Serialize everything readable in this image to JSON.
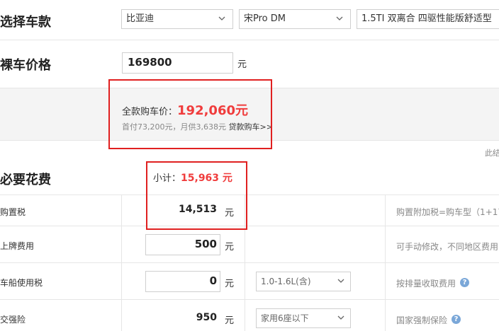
{
  "select_car": {
    "title": "选择车款",
    "brand": "比亚迪",
    "series": "宋Pro DM",
    "model": "1.5TI 双离合 四驱性能版舒适型"
  },
  "bare_price": {
    "title": "裸车价格",
    "value": "169800",
    "unit": "元"
  },
  "total": {
    "label": "全款购车价：",
    "value": "192,060元",
    "sub": "首付73,200元，月供3,638元",
    "loan_link": "贷款购车>>",
    "right_cut": "此结"
  },
  "required": {
    "title": "必要花费",
    "subtotal_label": "小计：",
    "subtotal_value": "15,963 元"
  },
  "rows": [
    {
      "label": "购置税",
      "value": "14,513",
      "unit": "元",
      "note": "购置附加税=购车型（1+17"
    },
    {
      "label": "上牌费用",
      "value": "500",
      "unit": "元",
      "note": "可手动修改，不同地区费用"
    },
    {
      "label": "车船使用税",
      "value": "0",
      "unit": "元",
      "option": "1.0-1.6L(含)",
      "note": "按排量收取费用"
    },
    {
      "label": "交强险",
      "value": "950",
      "unit": "元",
      "option": "家用6座以下",
      "note": "国家强制保险"
    }
  ],
  "colors": {
    "accent_red": "#f03c3c",
    "highlight_box": "#e02020",
    "help_icon": "#7aa7d8"
  }
}
